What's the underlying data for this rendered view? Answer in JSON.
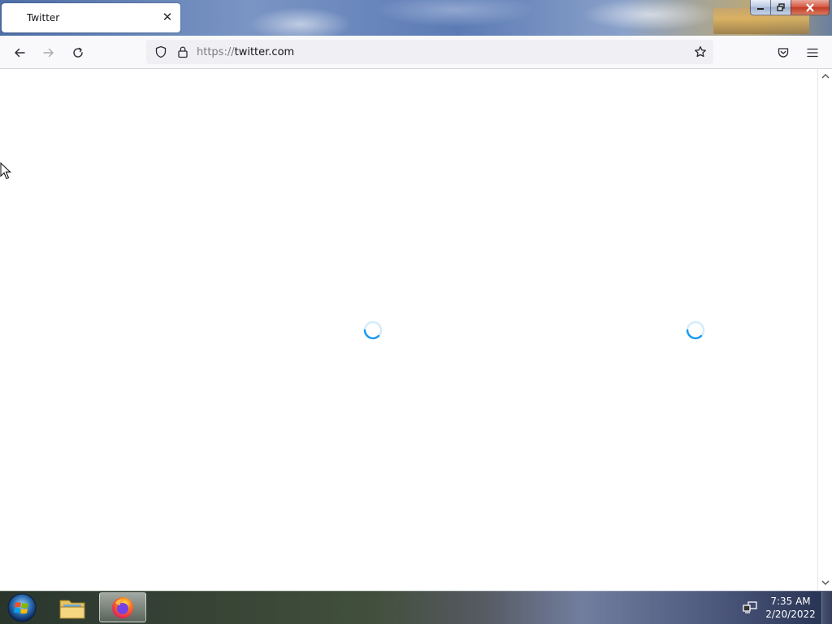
{
  "window": {
    "tab": {
      "title": "Twitter",
      "close_glyph": "✕"
    },
    "controls": {
      "minimize": "—",
      "maximize": "❐",
      "close": "✕"
    }
  },
  "navbar": {
    "back_icon": "arrow-left-icon",
    "forward_icon": "arrow-right-icon",
    "reload_icon": "reload-icon",
    "url": {
      "scheme": "https://",
      "host": "twitter.com"
    },
    "bookmark_icon": "star-icon",
    "pocket_icon": "pocket-icon",
    "menu_icon": "hamburger-menu-icon"
  },
  "content": {
    "spinners": [
      "loading-spinner",
      "loading-spinner"
    ],
    "spinner_color": "#1d9bf0"
  },
  "taskbar": {
    "items": [
      "start-button",
      "file-explorer",
      "firefox"
    ],
    "clock": {
      "time": "7:35 AM",
      "date": "2/20/2022"
    }
  }
}
